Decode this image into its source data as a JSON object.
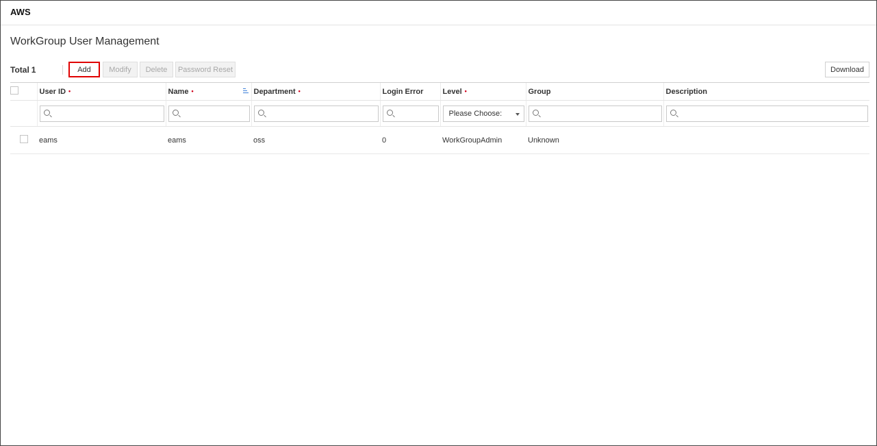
{
  "app": {
    "title": "AWS"
  },
  "page": {
    "title": "WorkGroup User Management"
  },
  "summary": {
    "total_label": "Total",
    "total_count": "1"
  },
  "toolbar": {
    "add_label": "Add",
    "modify_label": "Modify",
    "delete_label": "Delete",
    "password_reset_label": "Password Reset",
    "download_label": "Download"
  },
  "table": {
    "columns": [
      {
        "label": "User ID",
        "required": true
      },
      {
        "label": "Name",
        "required": true
      },
      {
        "label": "Department",
        "required": true
      },
      {
        "label": "Login Error",
        "required": false
      },
      {
        "label": "Level",
        "required": true
      },
      {
        "label": "Group",
        "required": false
      },
      {
        "label": "Description",
        "required": false
      }
    ],
    "required_mark": "•",
    "level_filter_value": "Please Choose:",
    "rows": [
      {
        "user_id": "eams",
        "name": "eams",
        "department": "oss",
        "login_error": "0",
        "level": "WorkGroupAdmin",
        "group": "Unknown",
        "description": ""
      }
    ]
  },
  "colors": {
    "highlight": "#e00000",
    "required": "#d0021b",
    "sort_icon": "#3b7fd9"
  }
}
